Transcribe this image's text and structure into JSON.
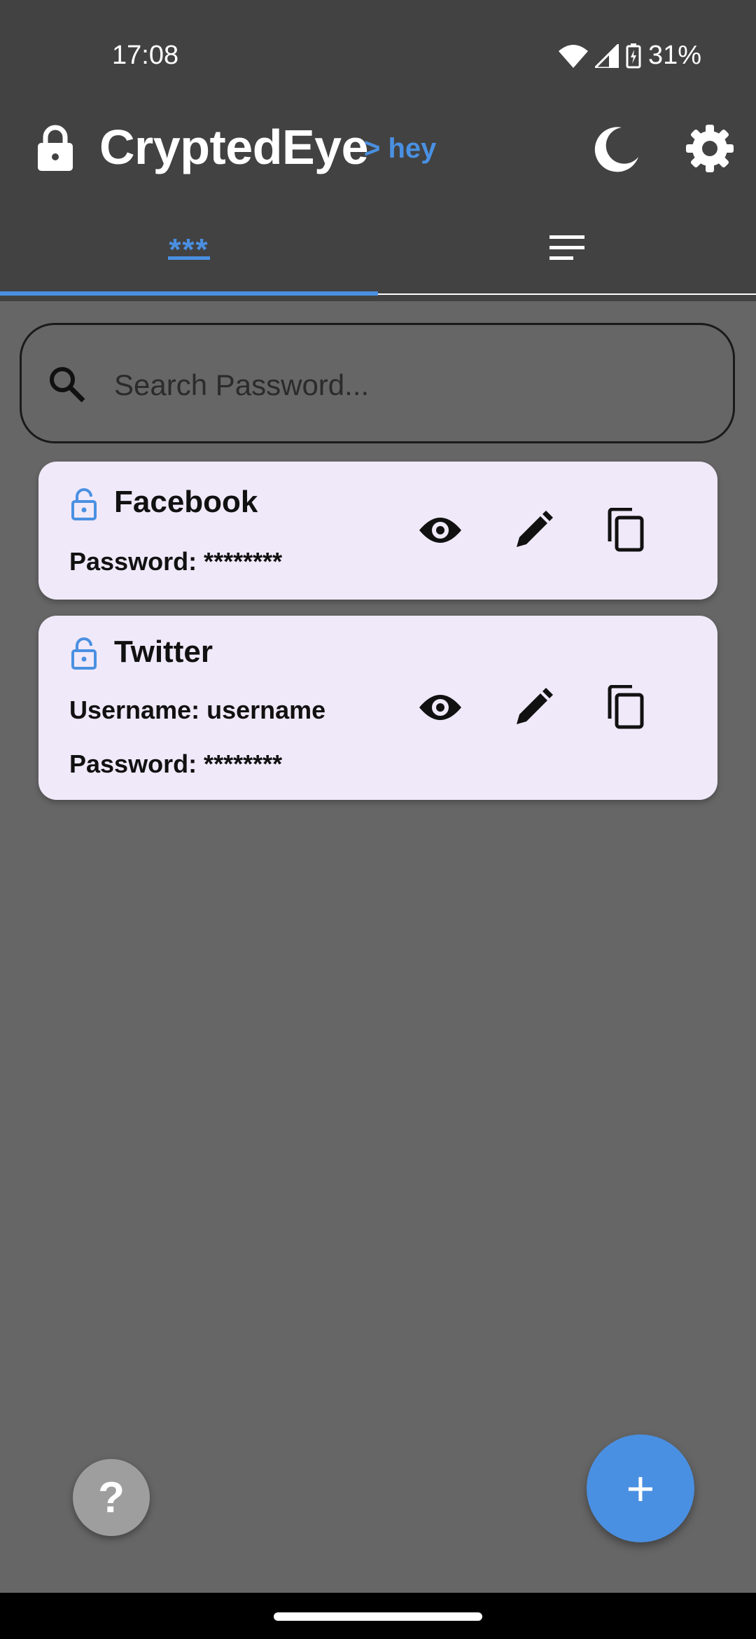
{
  "status": {
    "time": "17:08",
    "battery": "31%"
  },
  "app": {
    "title": "CryptedEye",
    "subtitle": "> hey"
  },
  "tabs": {
    "passwords_label": "***",
    "notes_icon": "menu-lines-icon"
  },
  "search": {
    "placeholder": "Search Password...",
    "value": ""
  },
  "entries": [
    {
      "title": "Facebook",
      "password": "Password: ********"
    },
    {
      "title": "Twitter",
      "username": "Username: username",
      "password": "Password: ********"
    }
  ],
  "fab": {
    "help": "?",
    "add": "+"
  },
  "colors": {
    "accent": "#4a90e2",
    "appbar": "#424242",
    "background": "#666666",
    "card": "#f0e9f9"
  }
}
